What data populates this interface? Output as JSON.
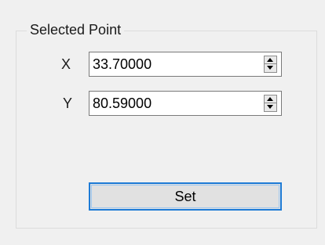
{
  "group": {
    "title": "Selected Point"
  },
  "fields": [
    {
      "label": "X",
      "value": "33.70000"
    },
    {
      "label": "Y",
      "value": "80.59000"
    }
  ],
  "set_button": {
    "label": "Set"
  },
  "colors": {
    "panel_bg": "#f0f0f0",
    "focus_border": "#1e7bd6",
    "button_bg": "#e1e1e1"
  },
  "icons": {
    "spin_up": "triangle-up-icon",
    "spin_down": "triangle-down-icon"
  }
}
